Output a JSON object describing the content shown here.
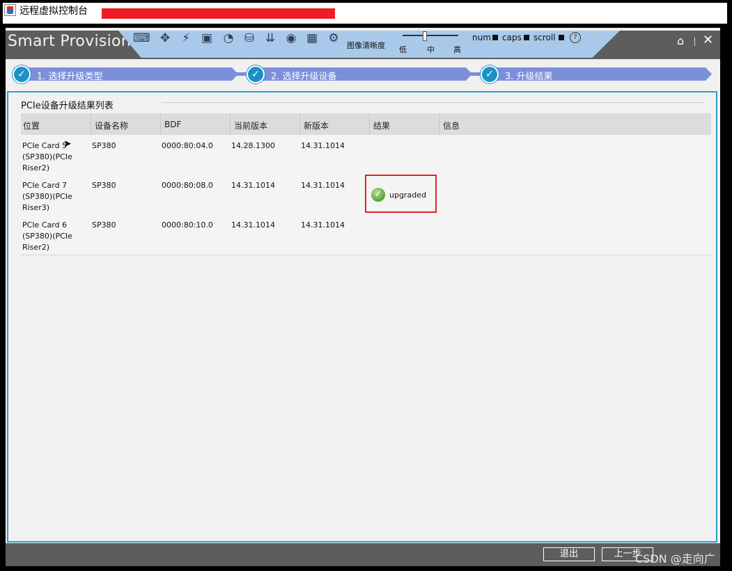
{
  "window": {
    "title": "远程虚拟控制台"
  },
  "app": {
    "brand": "Smart Provisioning"
  },
  "toolbar": {
    "icons": [
      "keyboard-icon",
      "move-icon",
      "lightning-icon",
      "film-icon",
      "mouse-icon",
      "disk-icon",
      "install-icon",
      "cd-icon",
      "image-icon",
      "settings-icon"
    ],
    "clarity_label": "图像清晰度",
    "clarity_levels": [
      "低",
      "中",
      "高"
    ],
    "locks": [
      "num",
      "caps",
      "scroll"
    ],
    "help": "?"
  },
  "steps": [
    {
      "label": "1. 选择升级类型"
    },
    {
      "label": "2. 选择升级设备"
    },
    {
      "label": "3. 升级结果"
    }
  ],
  "section": {
    "title": "PCIe设备升级结果列表"
  },
  "table": {
    "headers": [
      "位置",
      "设备名称",
      "BDF",
      "当前版本",
      "新版本",
      "结果",
      "信息"
    ],
    "rows": [
      {
        "location": "PCIe Card 5\n(SP380)(PCIe\nRiser2)",
        "name": "SP380",
        "bdf": "0000:80:04.0",
        "current": "14.28.1300",
        "new": "14.31.1014",
        "result": "",
        "info": ""
      },
      {
        "location": "PCIe Card 7\n(SP380)(PCIe\nRiser3)",
        "name": "SP380",
        "bdf": "0000:80:08.0",
        "current": "14.31.1014",
        "new": "14.31.1014",
        "result": "upgraded",
        "info": ""
      },
      {
        "location": "PCIe Card 6\n(SP380)(PCIe\nRiser2)",
        "name": "SP380",
        "bdf": "0000:80:10.0",
        "current": "14.31.1014",
        "new": "14.31.1014",
        "result": "",
        "info": ""
      }
    ]
  },
  "footer": {
    "exit_label": "退出",
    "prev_label": "上一步"
  },
  "watermark": "CSDN @走向广",
  "colors": {
    "accent": "#2aa0c9",
    "step": "#7b8fda",
    "highlight": "#d8232a",
    "header": "#5d5d5d",
    "toolbar": "#a9c9ea"
  }
}
